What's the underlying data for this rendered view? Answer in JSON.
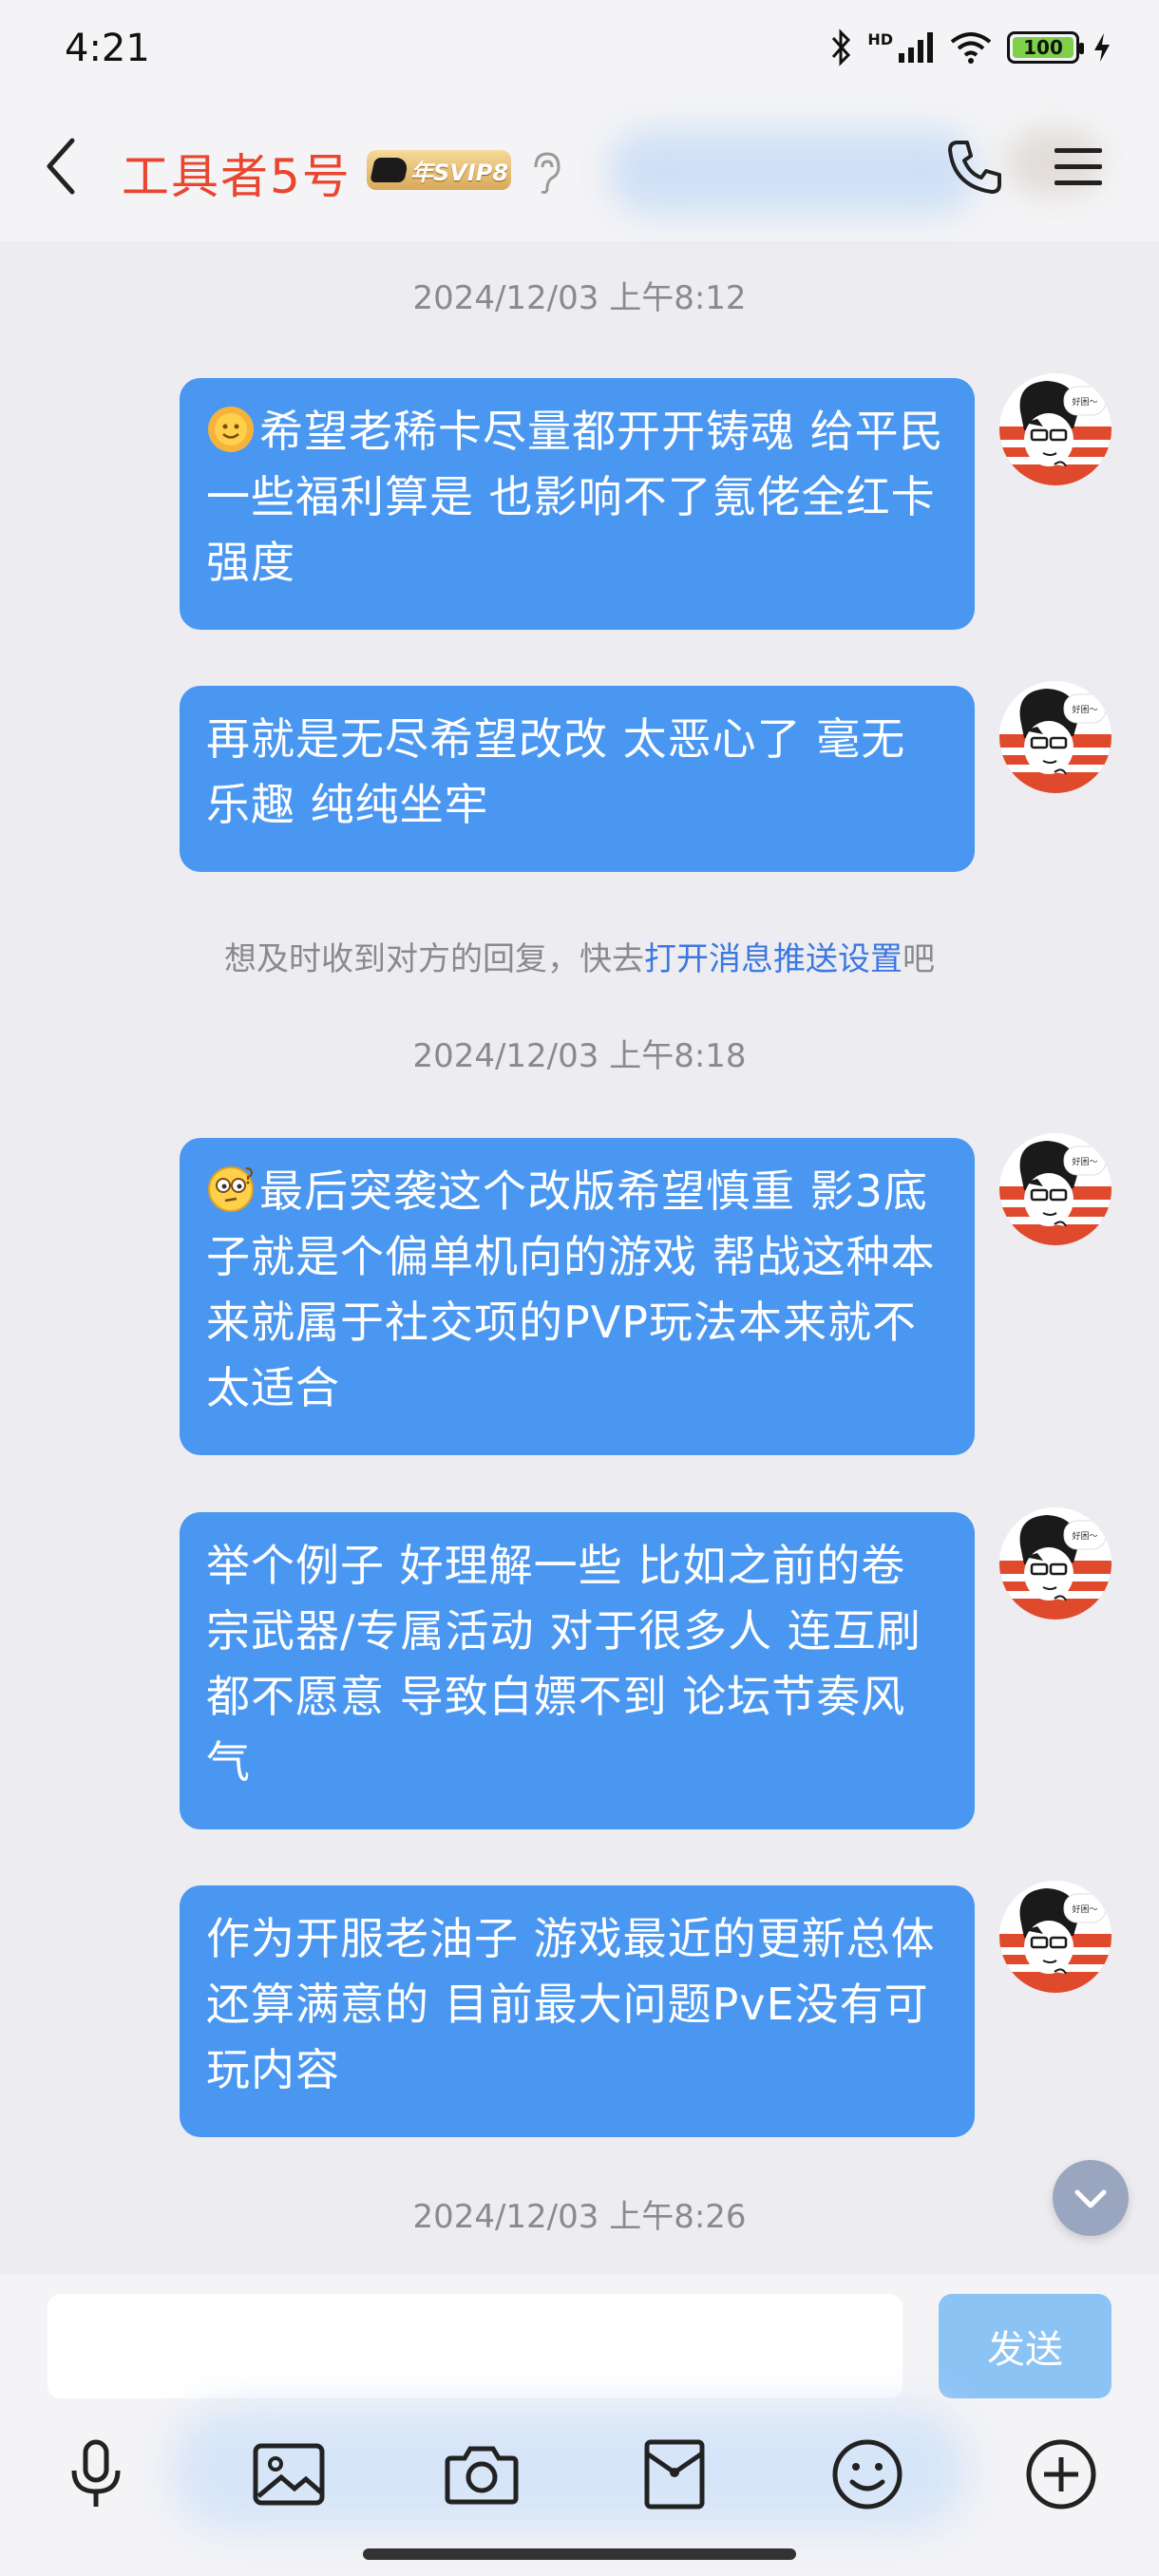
{
  "status_bar": {
    "time": "4:21",
    "battery": "100",
    "network_label": "HD"
  },
  "header": {
    "contact_name": "工具者5号",
    "badge_text": "年SVIP8"
  },
  "messages": [
    {
      "timestamp": "2024/12/03 上午8:12"
    },
    {
      "emoji": "sun-face-icon",
      "text": "希望老稀卡尽量都开开铸魂 给平民一些福利算是 也影响不了氪佬全红卡强度"
    },
    {
      "text": "再就是无尽希望改改 太恶心了 毫无乐趣 纯纯坐牢"
    },
    {
      "notice_prefix": "想及时收到对方的回复，快去",
      "notice_link": "打开消息推送设置",
      "notice_suffix": "吧"
    },
    {
      "timestamp": "2024/12/03 上午8:18"
    },
    {
      "emoji": "thinking-face-icon",
      "text": "最后突袭这个改版希望慎重 影3底子就是个偏单机向的游戏 帮战这种本来就属于社交项的PVP玩法本来就不太适合"
    },
    {
      "text": "举个例子 好理解一些 比如之前的卷宗武器/专属活动 对于很多人 连互刷都不愿意 导致白嫖不到 论坛节奏风气"
    },
    {
      "text": "作为开服老油子 游戏最近的更新总体还算满意的 目前最大问题PvE没有可玩内容"
    },
    {
      "timestamp": "2024/12/03 上午8:26"
    }
  ],
  "avatar_caption": "好困～",
  "input": {
    "placeholder": "",
    "send_label": "发送"
  },
  "toolbar": [
    "microphone-icon",
    "image-icon",
    "camera-icon",
    "red-packet-icon",
    "emoji-icon",
    "plus-icon"
  ],
  "colors": {
    "bubble": "#4a97f2",
    "name": "#e8462f",
    "link": "#3d78e0",
    "send_disabled": "#8cc3f5"
  }
}
